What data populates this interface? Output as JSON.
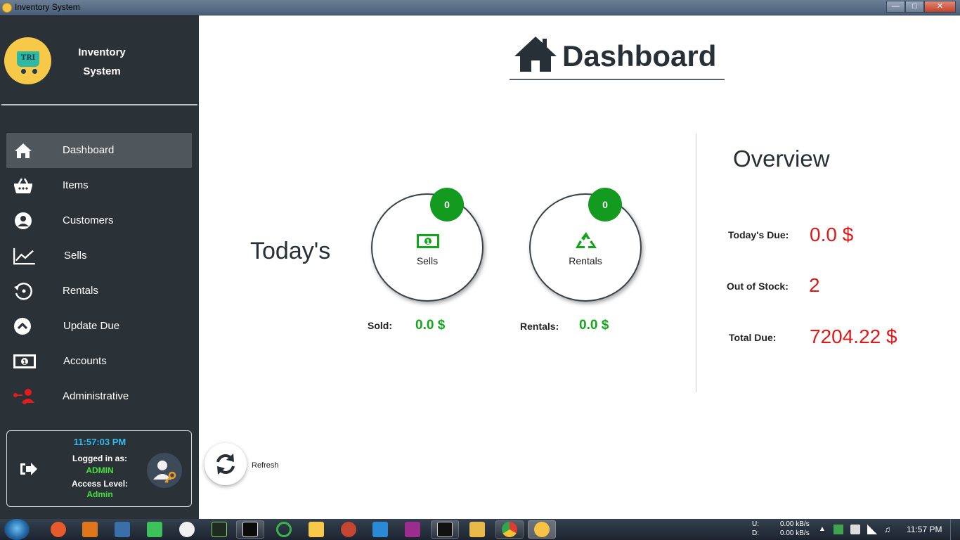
{
  "window": {
    "title": "Inventory System"
  },
  "sidebar": {
    "brand_line1": "Inventory",
    "brand_line2": "System",
    "logo_text": "TRI",
    "items": [
      {
        "label": "Dashboard",
        "icon": "home-icon",
        "active": true
      },
      {
        "label": "Items",
        "icon": "basket-icon"
      },
      {
        "label": "Customers",
        "icon": "user-circle-icon"
      },
      {
        "label": "Sells",
        "icon": "chart-line-icon"
      },
      {
        "label": "Rentals",
        "icon": "history-icon"
      },
      {
        "label": "Update Due",
        "icon": "chevron-up-circle-icon"
      },
      {
        "label": "Accounts",
        "icon": "money-bill-icon"
      },
      {
        "label": "Administrative",
        "icon": "admin-network-icon"
      }
    ],
    "session": {
      "time": "11:57:03 PM",
      "logged_in_label": "Logged in as:",
      "username": "ADMIN",
      "access_label": "Access Level:",
      "access_level": "Admin"
    }
  },
  "main": {
    "title": "Dashboard",
    "todays_label": "Today's",
    "sells": {
      "label": "Sells",
      "count": "0",
      "sold_label": "Sold:",
      "sold_value": "0.0 $"
    },
    "rentals": {
      "label": "Rentals",
      "count": "0",
      "rentals_label": "Rentals:",
      "rentals_value": "0.0 $"
    },
    "overview": {
      "title": "Overview",
      "todays_due_label": "Today's Due:",
      "todays_due_value": "0.0 $",
      "out_of_stock_label": "Out of Stock:",
      "out_of_stock_value": "2",
      "total_due_label": "Total Due:",
      "total_due_value": "7204.22 $"
    },
    "refresh_label": "Refresh"
  },
  "taskbar": {
    "net_u_label": "U:",
    "net_d_label": "D:",
    "net_u_value": "0.00 kB/s",
    "net_d_value": "0.00 kB/s",
    "clock": "11:57 PM"
  },
  "colors": {
    "sidebar_bg": "#2b3237",
    "accent_green": "#13a51c",
    "due_red": "#e01818",
    "clock_blue": "#33bbf0"
  }
}
